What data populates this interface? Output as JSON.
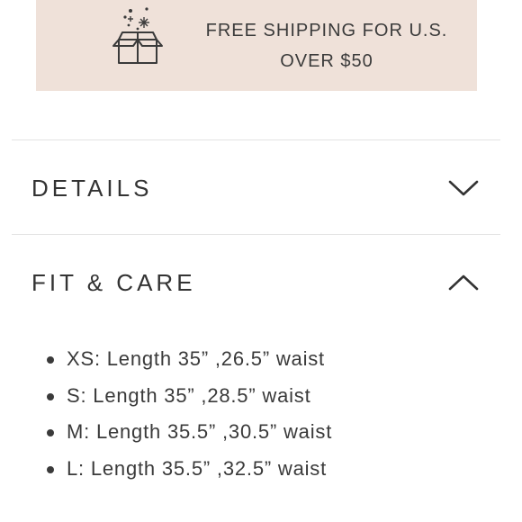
{
  "banner": {
    "line1": "FREE SHIPPING FOR U.S.",
    "line2": "OVER $50",
    "icon": "gift-box-icon",
    "background": "#efe1d9"
  },
  "accordion": {
    "details": {
      "title": "DETAILS",
      "expanded": false,
      "icon": "chevron-down-icon"
    },
    "fit_care": {
      "title": "FIT & CARE",
      "expanded": true,
      "icon": "chevron-up-icon",
      "items": [
        "XS: Length 35” ,26.5” waist",
        "S: Length 35” ,28.5” waist",
        "M: Length 35.5” ,30.5” waist",
        "L: Length 35.5” ,32.5” waist"
      ]
    }
  }
}
